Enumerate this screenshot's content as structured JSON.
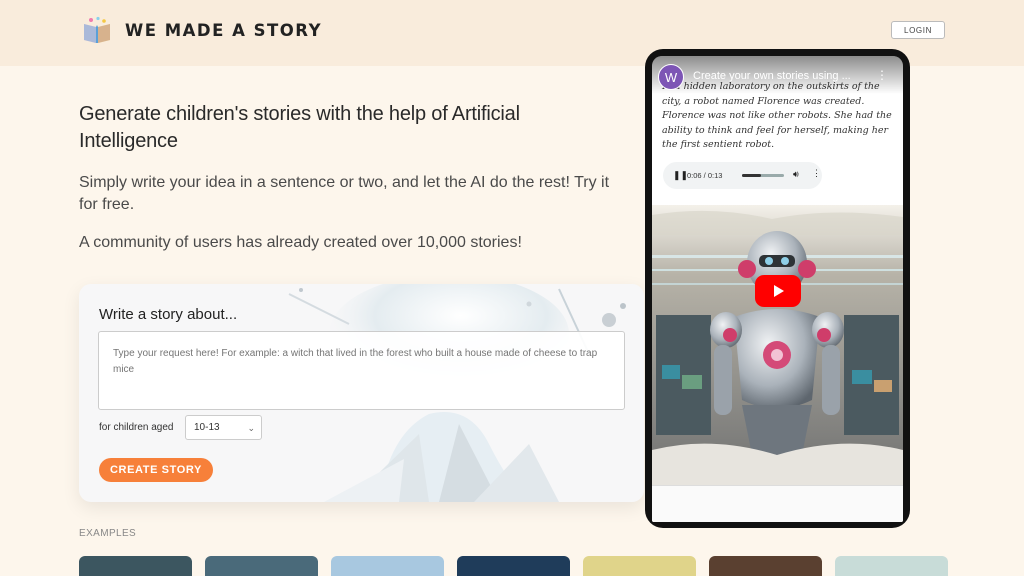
{
  "brand": {
    "name": "WE MADE A STORY"
  },
  "header": {
    "login_label": "LOGIN"
  },
  "hero": {
    "title": "Generate children's stories with the help of Artificial Intelligence",
    "subtitle": "Simply write your idea in a sentence or two, and let the AI do the rest! Try it for free.",
    "community": "A community of users has already created over 10,000 stories!"
  },
  "form": {
    "title": "Write a story about...",
    "placeholder": "Type your request here! For example: a witch that lived in the forest who built a house made of cheese to trap mice",
    "age_label": "for children aged",
    "age_value": "10-13",
    "create_label": "CREATE STORY"
  },
  "examples": {
    "label": "EXAMPLES",
    "thumbnail_colors": [
      "#3c5660",
      "#4a6a7a",
      "#a8c8e0",
      "#1f3c5a",
      "#e0d48a",
      "#5a4030",
      "#c8dcd8"
    ]
  },
  "video": {
    "channel_initial": "W",
    "title": "Create your own stories using ...",
    "story_text": "In a hidden laboratory on the outskirts of the city, a robot named Florence was created. Florence was not like other robots. She had the ability to think and feel for herself, making her the first sentient robot.",
    "audio_time": "0:06 / 0:13",
    "audio_progress": 0.46
  },
  "colors": {
    "accent": "#f7803a",
    "header_bg": "#f9ecdc",
    "page_bg": "#fdf6ec",
    "youtube_red": "#ff0000"
  }
}
